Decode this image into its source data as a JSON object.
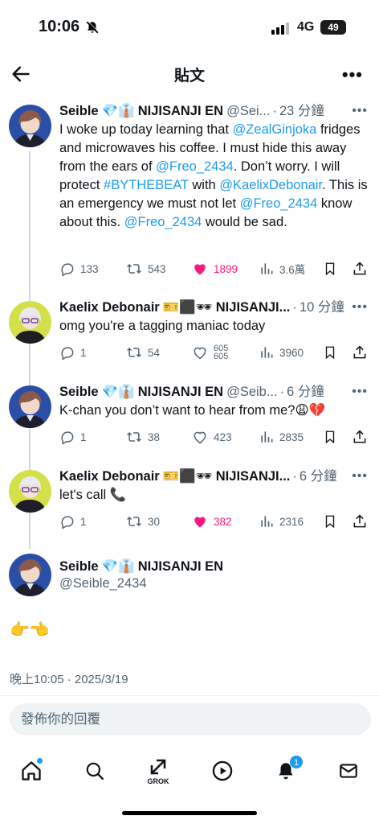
{
  "status_bar": {
    "time": "10:06",
    "network": "4G",
    "battery": "49"
  },
  "header": {
    "title": "貼文"
  },
  "tweets": [
    {
      "name": "Seible",
      "badges": "💎👔",
      "affiliation": "NIJISANJI EN",
      "handle": "@Sei...",
      "time": "23 分鐘",
      "text_html_parts": {
        "p1": "I woke up today learning that ",
        "m1": "@ZealGinjoka",
        "p2": " fridges and microwaves his coffee. I must hide this away from the ears of ",
        "m2": "@Freo_2434",
        "p3": ". Don’t worry. I will protect ",
        "tag": "#BYTHEBEAT",
        "p4": " with ",
        "m3": "@KaelixDebonair",
        "p5": ". This is an emergency we must not let ",
        "m4": "@Freo_2434",
        "p6": " know about this. ",
        "m5": "@Freo_2434",
        "p7": " would be sad."
      },
      "replies": "133",
      "retweets": "543",
      "likes": "1899",
      "views": "3.6萬"
    },
    {
      "name": "Kaelix Debonair",
      "badges": "🎫⬛🕶",
      "affiliation": "NIJISANJI...",
      "time": "10 分鐘",
      "text": "omg you're a tagging maniac today",
      "replies": "1",
      "retweets": "54",
      "likes_top": "605",
      "likes_bottom": "605",
      "views": "3960"
    },
    {
      "name": "Seible",
      "badges": "💎👔",
      "affiliation": "NIJISANJI EN",
      "handle": "@Seib...",
      "time": "6 分鐘",
      "text": "K-chan you don’t want to hear from me?😩💔",
      "replies": "1",
      "retweets": "38",
      "likes": "423",
      "views": "2835"
    },
    {
      "name": "Kaelix Debonair",
      "badges": "🎫⬛🕶",
      "affiliation": "NIJISANJI...",
      "time": "6 分鐘",
      "text": "let's call 📞",
      "replies": "1",
      "retweets": "30",
      "likes": "382",
      "views": "2316"
    }
  ],
  "main_tweet": {
    "name": "Seible",
    "badges": "💎👔",
    "affiliation": "NIJISANJI EN",
    "handle": "@Seible_2434",
    "text": "👉👈",
    "date": "晚上10:05 · 2025/3/19"
  },
  "reply_box": {
    "placeholder": "發佈你的回覆"
  },
  "nav": {
    "grok_label": "GROK",
    "notification_count": "1"
  },
  "colors": {
    "link": "#1d9bf0",
    "like": "#f91880",
    "muted": "#536471"
  }
}
